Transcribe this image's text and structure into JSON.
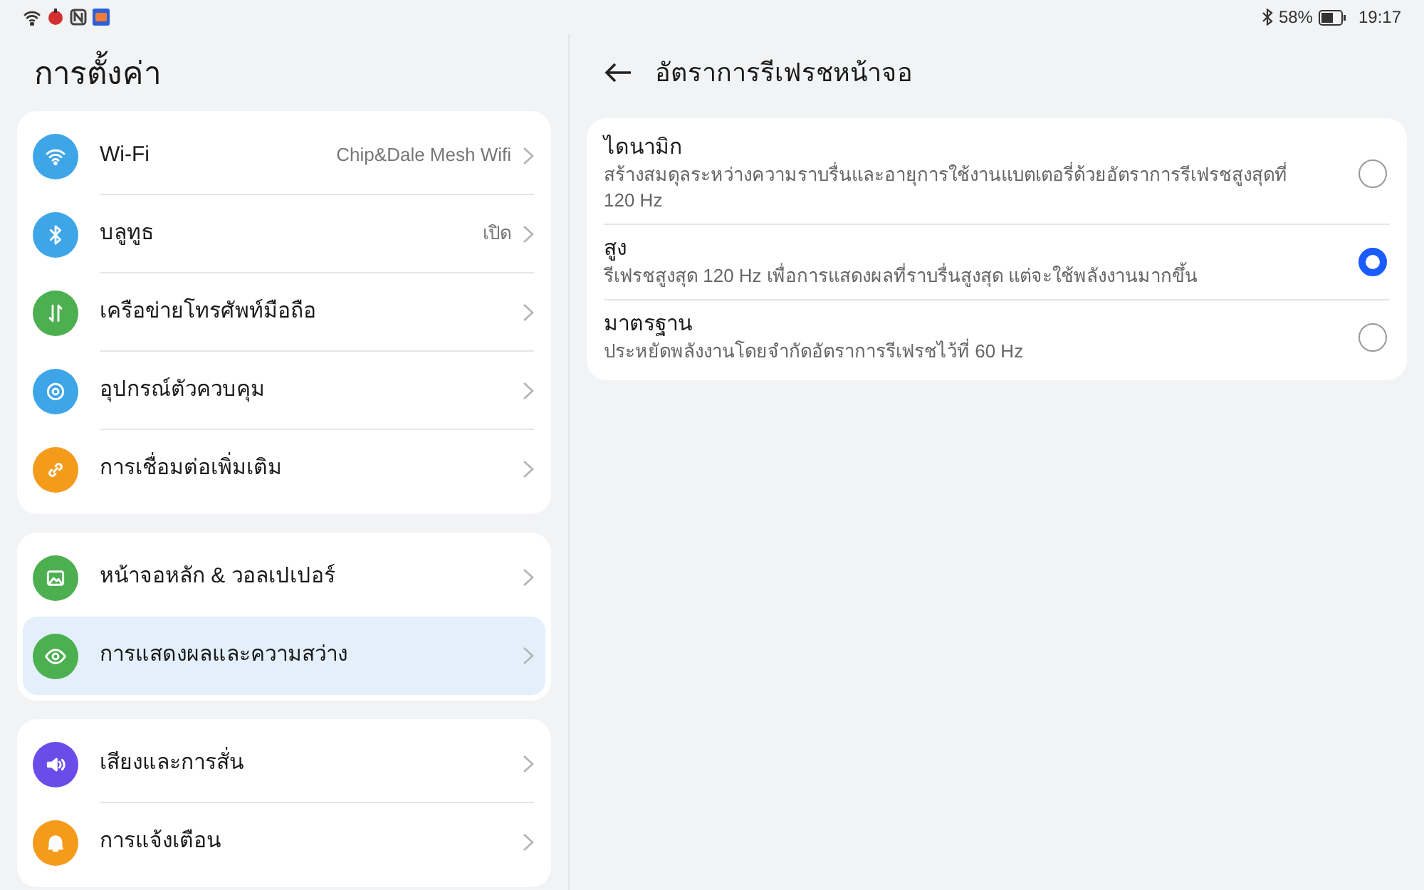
{
  "status_bar": {
    "battery": "58%",
    "time": "19:17"
  },
  "settings": {
    "title": "การตั้งค่า",
    "groups": [
      {
        "items": [
          {
            "kind": "wifi",
            "color": "#3ea6e8",
            "label": "Wi-Fi",
            "value": "Chip&Dale Mesh Wifi",
            "selected": false
          },
          {
            "kind": "bluetooth",
            "color": "#3ea6e8",
            "label": "บลูทูธ",
            "value": "เปิด",
            "selected": false
          },
          {
            "kind": "mobile",
            "color": "#4caf50",
            "label": "เครือข่ายโทรศัพท์มือถือ",
            "selected": false
          },
          {
            "kind": "remote",
            "color": "#3ea6e8",
            "label": "อุปกรณ์ตัวควบคุม",
            "selected": false
          },
          {
            "kind": "link",
            "color": "#f59b1c",
            "label": "การเชื่อมต่อเพิ่มเติม",
            "selected": false
          }
        ]
      },
      {
        "items": [
          {
            "kind": "image",
            "color": "#4caf50",
            "label": "หน้าจอหลัก & วอลเปเปอร์",
            "selected": false
          },
          {
            "kind": "eye",
            "color": "#4caf50",
            "label": "การแสดงผลและความสว่าง",
            "selected": true
          }
        ]
      },
      {
        "items": [
          {
            "kind": "sound",
            "color": "#6a4de8",
            "label": "เสียงและการสั่น",
            "selected": false
          },
          {
            "kind": "bell",
            "color": "#f59b1c",
            "label": "การแจ้งเตือน",
            "selected": false
          }
        ]
      }
    ]
  },
  "detail": {
    "title": "อัตราการรีเฟรชหน้าจอ",
    "options": [
      {
        "title": "ไดนามิก",
        "description": "สร้างสมดุลระหว่างความราบรื่นและอายุการใช้งานแบตเตอรี่ด้วยอัตราการรีเฟรชสูงสุดที่ 120 Hz",
        "selected": false
      },
      {
        "title": "สูง",
        "description": "รีเฟรชสูงสุด 120 Hz เพื่อการแสดงผลที่ราบรื่นสูงสุด แต่จะใช้พลังงานมากขึ้น",
        "selected": true
      },
      {
        "title": "มาตรฐาน",
        "description": "ประหยัดพลังงานโดยจำกัดอัตราการรีเฟรชไว้ที่ 60 Hz",
        "selected": false
      }
    ]
  }
}
